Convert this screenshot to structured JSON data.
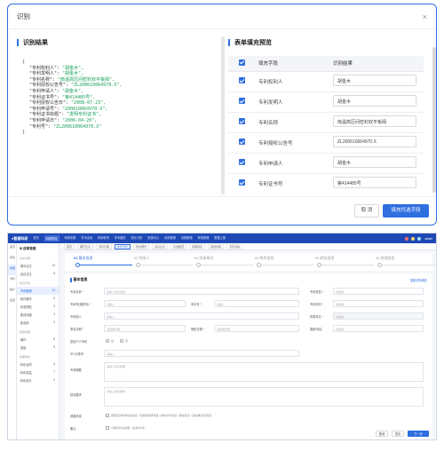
{
  "dialog": {
    "title": "识别",
    "close_icon": "×",
    "left_section_title": "识别结果",
    "right_section_title": "表单填充预览",
    "json_open": "{",
    "json_close": "}",
    "json_lines": [
      {
        "key": "\"专利权利人\": ",
        "value": "\"胡金木\","
      },
      {
        "key": "\"专利发明人\": ",
        "value": "\"胡金木\","
      },
      {
        "key": "\"专利名称\": ",
        "value": "\"南温高压间密封双平板阀\","
      },
      {
        "key": "\"专利授权公告号\": ",
        "value": "\"ZL200610064970.X\","
      },
      {
        "key": "\"专利申请人\": ",
        "value": "\"胡金木\","
      },
      {
        "key": "\"专利证书号\": ",
        "value": "\"第414485号\","
      },
      {
        "key": "\"专利授权公告日\": ",
        "value": "\"2008-07-23\","
      },
      {
        "key": "\"专利申请号\": ",
        "value": "\"200610064970.X\","
      },
      {
        "key": "\"专利证书标题\": ",
        "value": "\"发明专利证书\","
      },
      {
        "key": "\"专利申请日\": ",
        "value": "\"2006-04-20\","
      },
      {
        "key": "\"专利号\": ",
        "value": "\"ZL200610064970.X\""
      }
    ],
    "table_headers": {
      "field": "填充字段",
      "result": "识别结果"
    },
    "rows": [
      {
        "field": "专利权利人",
        "value": "胡金木"
      },
      {
        "field": "专利发明人",
        "value": "胡金木"
      },
      {
        "field": "专利名称",
        "value": "南温高压间密封双平板阀"
      },
      {
        "field": "专利授权公告号",
        "value": "ZL200610064970.X"
      },
      {
        "field": "专利申请人",
        "value": "胡金木"
      },
      {
        "field": "专利证书号",
        "value": "第414485号"
      }
    ],
    "cancel_label": "取 消",
    "fill_label": "填充托选字段",
    "accent": "#2f6fe0"
  },
  "app": {
    "logo": "●智慧科研",
    "nav": [
      "首页",
      "科研项目",
      "科研成果",
      "学术活动",
      "科研机构",
      "学术团队",
      "统计分析",
      "资源中心",
      "系统管理",
      "流程管理",
      "审批管理",
      "数据上报"
    ],
    "nav_active_index": 1,
    "user": "admin",
    "rail": [
      "首页",
      "项目",
      "成果",
      "专利",
      "统计",
      "设置"
    ],
    "side_head": "⊞ 成果管理",
    "side_groups": [
      {
        "title": "论文管理",
        "items": [
          {
            "label": "期刊论文",
            "count": "12"
          },
          {
            "label": "会议论文",
            "count": "8"
          }
        ]
      },
      {
        "title": "知识产权",
        "items": [
          {
            "label": "专利管理",
            "count": "24"
          },
          {
            "label": "软件著作",
            "count": "6"
          },
          {
            "label": "标准规范",
            "count": "3"
          },
          {
            "label": "集成电路",
            "count": "1"
          },
          {
            "label": "新品种",
            "count": "2"
          }
        ]
      },
      {
        "title": "其他成果",
        "items": [
          {
            "label": "著作",
            "count": "5"
          },
          {
            "label": "奖励",
            "count": "9"
          }
        ]
      },
      {
        "title": "成果转化",
        "items": [
          {
            "label": "转化合同",
            "count": "4"
          },
          {
            "label": "转化收益",
            "count": "7"
          },
          {
            "label": "转化统计",
            "count": "2"
          }
        ]
      }
    ],
    "side_active": "专利管理",
    "tabs": [
      "首页",
      "期刊论文",
      "专利管理",
      "新增专利",
      "软件著作",
      "会议论文",
      "标准规范",
      "成果转化",
      "其他成果",
      "专利详情"
    ],
    "tab_active_index": 3,
    "steps": [
      {
        "num": "01",
        "label": "基本信息"
      },
      {
        "num": "02",
        "label": "完成人"
      },
      {
        "num": "03",
        "label": "完成单位"
      },
      {
        "num": "04",
        "label": "附件信息"
      },
      {
        "num": "05",
        "label": "转化信息"
      },
      {
        "num": "06",
        "label": "其他信息"
      },
      {
        "num": "07",
        "label": "提交审核"
      }
    ],
    "form_title": "基本信息",
    "form_link": "智能识别填充",
    "labels": {
      "name": "专利名称 *",
      "type": "专利类型 *",
      "status": "专利状态 *",
      "patent_no": "专利号(授权号) *",
      "apply_no": "申请号 *",
      "owner": "专利权人",
      "apply_date": "申请日期 *",
      "grant_date": "授权日期 *",
      "country": "国家/地区",
      "unit": "所属单位 *",
      "pct": "是否PCT专利",
      "ipc": "IPC分类号",
      "abstract": "专利摘要",
      "claims": "权利要求",
      "source": "成果来源",
      "remark": "备注"
    },
    "placeholders": {
      "input": "请输入",
      "select": "请选择",
      "name_hint": "请输入专利名称",
      "date": "请选择日期",
      "abstract": "请输入专利摘要",
      "claims": "请输入权利要求"
    },
    "radio_yes": "是",
    "radio_no": "否",
    "source_hint": "国家自然科学基金项目 / 省部级科研项目 / 横向合作项目 / 其他来源（请选择对应项目）",
    "remark_hint": "可填写补充说明，最多500字",
    "btn_cancel": "取消",
    "btn_save": "暂存",
    "btn_next": "下一步"
  }
}
